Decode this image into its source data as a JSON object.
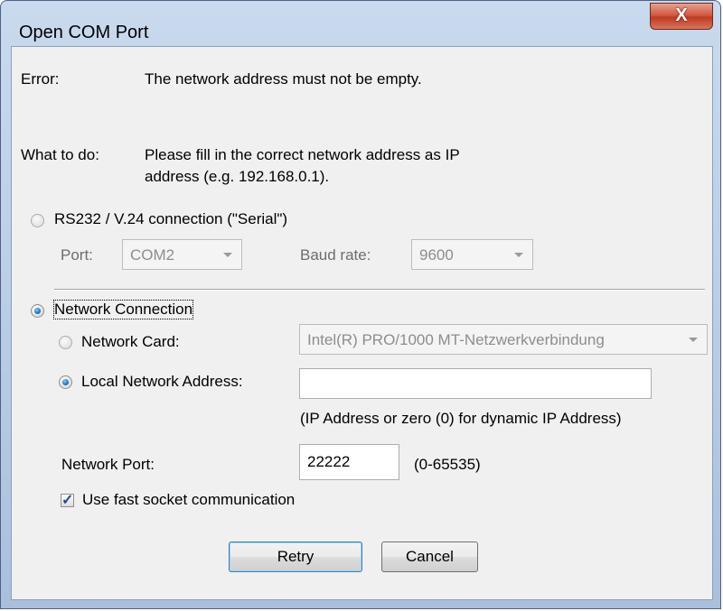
{
  "window": {
    "title": "Open COM Port",
    "close_label": "X"
  },
  "error": {
    "label": "Error:",
    "message": "The network address must not be empty."
  },
  "todo": {
    "label": "What to do:",
    "line1": "Please fill in the correct network address as IP",
    "line2": "address (e.g. 192.168.0.1)."
  },
  "serial": {
    "label": "RS232 / V.24 connection (\"Serial\")",
    "selected": false,
    "port_label": "Port:",
    "port_value": "COM2",
    "baud_label": "Baud rate:",
    "baud_value": "9600"
  },
  "network": {
    "label": "Network Connection",
    "selected": true,
    "card_label": "Network Card:",
    "card_value": "Intel(R) PRO/1000 MT-Netzwerkverbindung",
    "card_selected": false,
    "local_label": "Local Network Address:",
    "local_selected": true,
    "local_value": "",
    "local_hint": "(IP Address or zero (0) for dynamic IP Address)",
    "port_label": "Network Port:",
    "port_value": "22222",
    "port_range": "(0-65535)"
  },
  "fast_socket": {
    "label": "Use fast socket communication",
    "checked": true
  },
  "buttons": {
    "retry": "Retry",
    "cancel": "Cancel"
  },
  "colors": {
    "title_gradient": "#c9daee",
    "client_bg": "#f0f0f0",
    "close_red": "#c13a22",
    "radio_blue": "#1f6fc4"
  }
}
